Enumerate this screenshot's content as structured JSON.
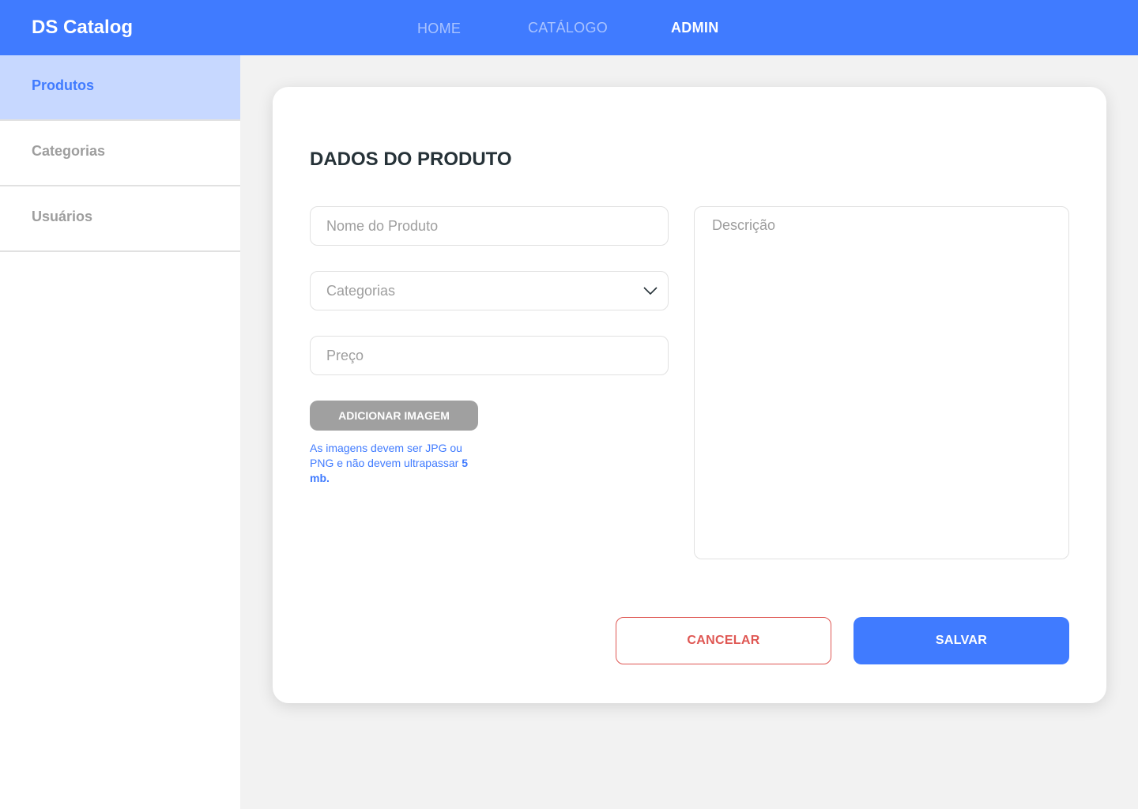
{
  "navbar": {
    "brand": "DS Catalog",
    "links": [
      {
        "label": "HOME"
      },
      {
        "label": "CATÁLOGO"
      },
      {
        "label": "ADMIN",
        "active": true
      }
    ],
    "background_color": "#407BFF"
  },
  "sidebar": {
    "items": [
      {
        "label": "Produtos",
        "active": true
      },
      {
        "label": "Categorias"
      },
      {
        "label": "Usuários"
      }
    ]
  },
  "form": {
    "title": "DADOS DO PRODUTO",
    "name_placeholder": "Nome do Produto",
    "categories_placeholder": "Categorias",
    "price_placeholder": "Preço",
    "description_placeholder": "Descrição",
    "add_image_label": "ADICIONAR IMAGEM",
    "image_hint": "As imagens devem ser  JPG ou PNG e não devem ultrapassar",
    "image_hint_bold": "5 mb.",
    "cancel_label": "CANCELAR",
    "save_label": "SALVAR"
  },
  "colors": {
    "accent": "#407BFF",
    "cancel": "#DF5753",
    "active_sidebar_bg": "#C7D8FF"
  }
}
